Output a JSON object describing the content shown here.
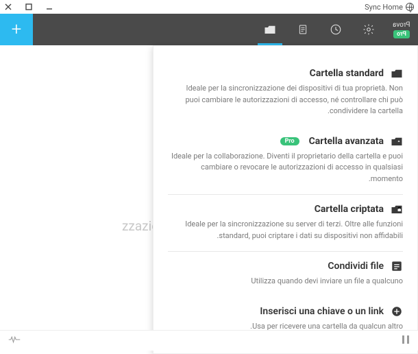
{
  "window": {
    "title": "Sync Home"
  },
  "toolbar": {
    "trial_label": "Prova",
    "pro_badge": "Pro"
  },
  "behind_text": "zzazione",
  "menu": {
    "standard": {
      "title": "Cartella standard",
      "desc": "Ideale per la sincronizzazione dei dispositivi di tua proprietà. Non puoi cambiare le autorizzazioni di accesso, né controllare chi può condividere la cartella."
    },
    "advanced": {
      "title": "Cartella avanzata",
      "pro": "Pro",
      "desc": "Ideale per la collaborazione. Diventi il proprietario della cartella e puoi cambiare o revocare le autorizzazioni di accesso in qualsiasi momento."
    },
    "encrypted": {
      "title": "Cartella criptata",
      "desc": "Ideale per la sincronizzazione su server di terzi. Oltre alle funzioni standard, puoi criptare i dati su dispositivi non affidabili."
    },
    "share": {
      "title": "Condividi file",
      "desc": "Utilizza quando devi inviare un file a qualcuno"
    },
    "enter": {
      "title": "Inserisci una chiave o un link",
      "desc": "Usa per ricevere una cartella da qualcun altro."
    }
  }
}
